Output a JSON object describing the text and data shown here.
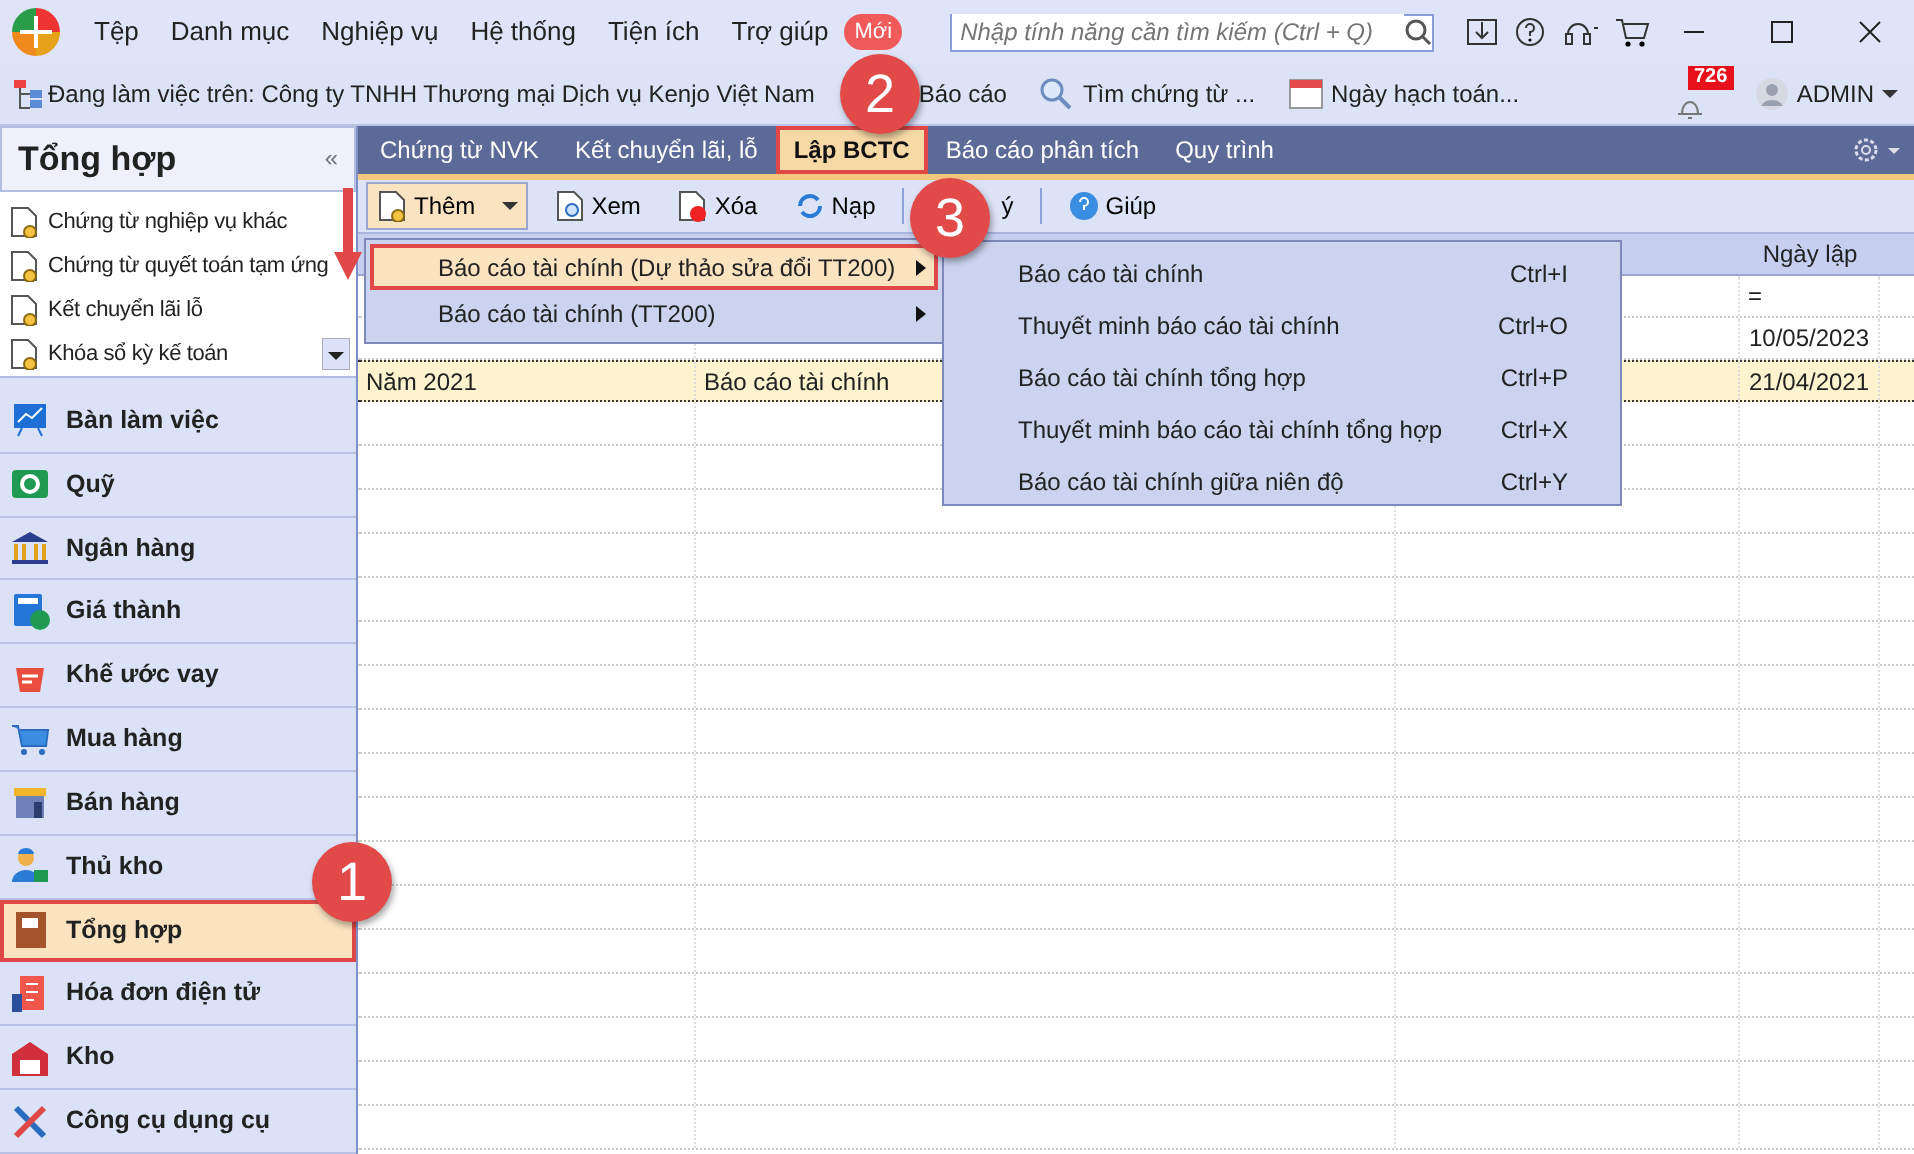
{
  "app_menu": [
    "Tệp",
    "Danh mục",
    "Nghiệp vụ",
    "Hệ thống",
    "Tiện ích",
    "Trợ giúp"
  ],
  "new_badge": "Mới",
  "search": {
    "placeholder": "Nhập tính năng cần tìm kiếm (Ctrl + Q)"
  },
  "infobar": {
    "company": "Đang làm việc trên:  Công ty TNHH Thương mại Dịch vụ Kenjo Việt Nam",
    "links": [
      {
        "label": "Báo cáo",
        "kind": "report"
      },
      {
        "label": "Tìm chứng từ ...",
        "kind": "search"
      },
      {
        "label": "Ngày hạch toán...",
        "kind": "calendar"
      }
    ],
    "notification_count": "726",
    "user": "ADMIN"
  },
  "sidebar": {
    "title": "Tổng hợp",
    "collapse": "«",
    "quick_items": [
      "Chứng từ nghiệp vụ khác",
      "Chứng từ quyết toán tạm ứng",
      "Kết chuyển lãi lỗ",
      "Khóa sổ kỳ kế toán"
    ],
    "modules": [
      {
        "label": "Bàn làm việc",
        "selected": false
      },
      {
        "label": "Quỹ",
        "selected": false
      },
      {
        "label": "Ngân hàng",
        "selected": false
      },
      {
        "label": "Giá thành",
        "selected": false
      },
      {
        "label": "Khế ước vay",
        "selected": false
      },
      {
        "label": "Mua hàng",
        "selected": false
      },
      {
        "label": "Bán hàng",
        "selected": false
      },
      {
        "label": "Thủ kho",
        "selected": false
      },
      {
        "label": "Tổng hợp",
        "selected": true
      },
      {
        "label": "Hóa đơn điện tử",
        "selected": false
      },
      {
        "label": "Kho",
        "selected": false
      },
      {
        "label": "Công cụ dụng cụ",
        "selected": false
      }
    ]
  },
  "tabs": [
    {
      "label": "Chứng từ NVK",
      "selected": false
    },
    {
      "label": "Kết chuyển lãi, lỗ",
      "selected": false
    },
    {
      "label": "Lập BCTC",
      "selected": true
    },
    {
      "label": "Báo cáo phân tích",
      "selected": false
    },
    {
      "label": "Quy trình",
      "selected": false
    }
  ],
  "toolbar": [
    {
      "label": "Thêm",
      "kind": "add",
      "selected": true
    },
    {
      "label": "Xem",
      "kind": "view",
      "selected": false
    },
    {
      "label": "Xóa",
      "kind": "delete",
      "selected": false
    },
    {
      "label": "Nạp",
      "kind": "reload",
      "selected": false
    },
    {
      "label": "ý",
      "kind": "partial",
      "selected": false
    },
    {
      "label": "Giúp",
      "kind": "help",
      "selected": false
    }
  ],
  "table": {
    "date_header": "Ngày lập",
    "filter_operator": "=",
    "rows": [
      {
        "date": "10/05/2023",
        "selected": false
      },
      {
        "column_1": "Năm 2021",
        "column_2": "Báo cáo tài chính",
        "date": "21/04/2021",
        "selected": true
      }
    ]
  },
  "add_menu": {
    "items": [
      {
        "label": "Báo cáo tài chính (Dự thảo sửa đổi TT200)",
        "selected": true
      },
      {
        "label": "Báo cáo tài chính (TT200)",
        "selected": false
      }
    ],
    "submenu": [
      {
        "label": "Báo cáo tài chính",
        "shortcut": "Ctrl+I"
      },
      {
        "label": "Thuyết minh báo cáo tài chính",
        "shortcut": "Ctrl+O"
      },
      {
        "label": "Báo cáo tài chính tổng hợp",
        "shortcut": "Ctrl+P"
      },
      {
        "label": "Thuyết minh báo cáo tài chính tổng hợp",
        "shortcut": "Ctrl+X"
      },
      {
        "label": "Báo cáo tài chính giữa niên độ",
        "shortcut": "Ctrl+Y"
      }
    ]
  },
  "callouts": [
    "1",
    "2",
    "3"
  ]
}
